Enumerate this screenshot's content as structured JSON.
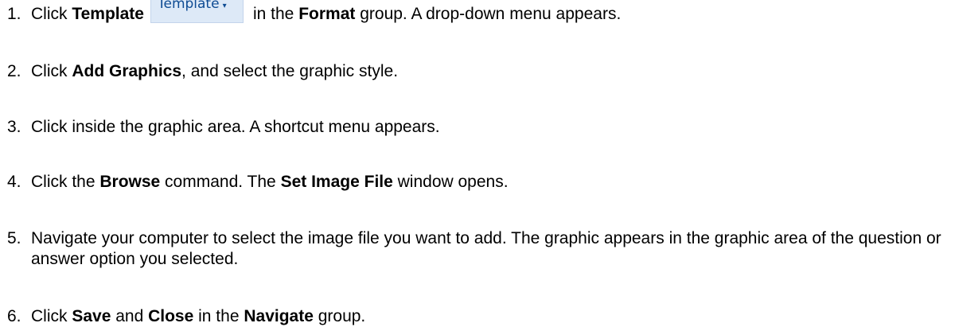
{
  "steps": [
    {
      "num": "1.",
      "t1": "Click ",
      "b1": "Template",
      "button_label": "Template",
      "button_arrow": "▾",
      "t2": "in the ",
      "b2": "Format",
      "t3": " group. A drop-down menu appears."
    },
    {
      "num": "2.",
      "t1": "Click ",
      "b1": "Add Graphics",
      "t2": ", and select the graphic style."
    },
    {
      "num": "3.",
      "t1": "Click inside the graphic area. A shortcut menu appears."
    },
    {
      "num": "4.",
      "t1": "Click the ",
      "b1": "Browse",
      "t2": " command. The ",
      "b2": "Set Image File",
      "t3": " window opens."
    },
    {
      "num": "5.",
      "t1": "Navigate your computer to select the image file you want to add. The graphic appears in the graphic area of the question or answer option you selected."
    },
    {
      "num": "6.",
      "t1": "Click ",
      "b1": "Save",
      "t2": " and ",
      "b2": "Close",
      "t3": " in the ",
      "b3": "Navigate",
      "t4": " group."
    }
  ]
}
